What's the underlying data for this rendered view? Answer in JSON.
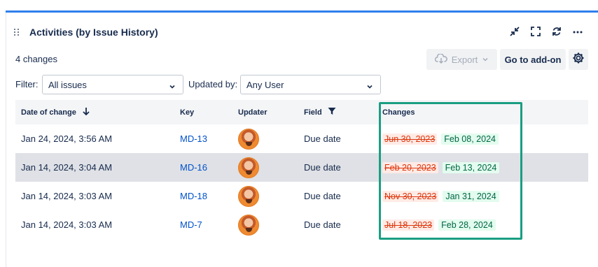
{
  "header": {
    "title": "Activities (by Issue History)"
  },
  "summary": {
    "changes_count": "4 changes"
  },
  "toolbar": {
    "export_label": "Export",
    "goto_addon_label": "Go to add-on"
  },
  "filters": {
    "filter_label": "Filter:",
    "filter_value": "All issues",
    "updated_by_label": "Updated by:",
    "updated_by_value": "Any User"
  },
  "table": {
    "columns": {
      "date": "Date of change",
      "key": "Key",
      "updater": "Updater",
      "field": "Field",
      "changes": "Changes"
    },
    "rows": [
      {
        "date": "Jan 24, 2024, 3:56 AM",
        "key": "MD-13",
        "field": "Due date",
        "old": "Jun 30, 2023",
        "new": "Feb 08, 2024"
      },
      {
        "date": "Jan 14, 2024, 3:04 AM",
        "key": "MD-16",
        "field": "Due date",
        "old": "Feb 20, 2023",
        "new": "Feb 13, 2024"
      },
      {
        "date": "Jan 14, 2024, 3:03 AM",
        "key": "MD-18",
        "field": "Due date",
        "old": "Nov 30, 2023",
        "new": "Jan 31, 2024"
      },
      {
        "date": "Jan 14, 2024, 3:03 AM",
        "key": "MD-7",
        "field": "Due date",
        "old": "Jul 18, 2023",
        "new": "Feb 28, 2024"
      }
    ],
    "selected_row": 1
  },
  "colors": {
    "accent_bar": "#2f80ed",
    "link": "#0052cc",
    "highlight_box": "#1a9e82",
    "old_bg": "#ffebe6",
    "new_bg": "#e3fcef"
  },
  "icons": [
    "drag-handle-icon",
    "collapse-icon",
    "fullscreen-icon",
    "refresh-icon",
    "more-icon",
    "cloud-download-icon",
    "chevron-down-icon",
    "gear-icon",
    "sort-down-arrow-icon",
    "filter-icon"
  ]
}
